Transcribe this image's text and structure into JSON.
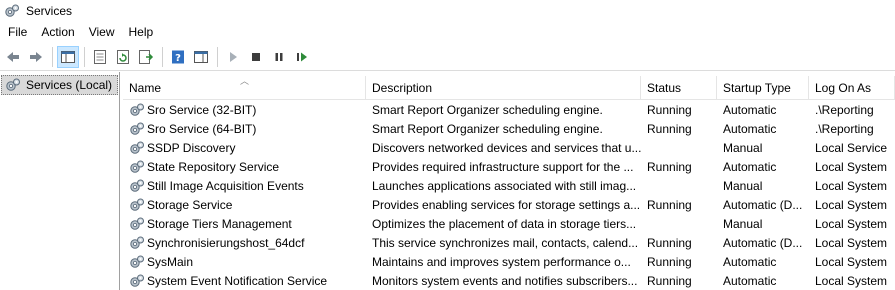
{
  "window": {
    "title": "Services",
    "icon": "services-gear-icon"
  },
  "menu": {
    "items": [
      "File",
      "Action",
      "View",
      "Help"
    ]
  },
  "toolbar": {
    "buttons": [
      {
        "name": "back-icon"
      },
      {
        "name": "forward-icon"
      },
      {
        "name": "show-hide-console-tree-icon"
      },
      {
        "name": "properties-icon"
      },
      {
        "name": "refresh-icon"
      },
      {
        "name": "export-list-icon"
      },
      {
        "name": "help-icon"
      },
      {
        "name": "show-action-pane-icon"
      },
      {
        "name": "start-service-icon"
      },
      {
        "name": "stop-service-icon"
      },
      {
        "name": "pause-service-icon"
      },
      {
        "name": "restart-service-icon"
      }
    ]
  },
  "tree": {
    "selected": "Services (Local)"
  },
  "table": {
    "columns": [
      "Name",
      "Description",
      "Status",
      "Startup Type",
      "Log On As"
    ],
    "rows": [
      {
        "name": "Sro Service (32-BIT)",
        "description": "Smart Report Organizer scheduling engine.",
        "status": "Running",
        "startup": "Automatic",
        "logon": ".\\Reporting"
      },
      {
        "name": "Sro Service (64-BIT)",
        "description": "Smart Report Organizer scheduling engine.",
        "status": "Running",
        "startup": "Automatic",
        "logon": ".\\Reporting"
      },
      {
        "name": "SSDP Discovery",
        "description": "Discovers networked devices and services that u...",
        "status": "",
        "startup": "Manual",
        "logon": "Local Service"
      },
      {
        "name": "State Repository Service",
        "description": "Provides required infrastructure support for the ...",
        "status": "Running",
        "startup": "Automatic",
        "logon": "Local System"
      },
      {
        "name": "Still Image Acquisition Events",
        "description": "Launches applications associated with still imag...",
        "status": "",
        "startup": "Manual",
        "logon": "Local System"
      },
      {
        "name": "Storage Service",
        "description": "Provides enabling services for storage settings a...",
        "status": "Running",
        "startup": "Automatic (D...",
        "logon": "Local System"
      },
      {
        "name": "Storage Tiers Management",
        "description": "Optimizes the placement of data in storage tiers...",
        "status": "",
        "startup": "Manual",
        "logon": "Local System"
      },
      {
        "name": "Synchronisierungshost_64dcf",
        "description": "This service synchronizes mail, contacts, calend...",
        "status": "Running",
        "startup": "Automatic (D...",
        "logon": "Local System"
      },
      {
        "name": "SysMain",
        "description": "Maintains and improves system performance o...",
        "status": "Running",
        "startup": "Automatic",
        "logon": "Local System"
      },
      {
        "name": "System Event Notification Service",
        "description": "Monitors system events and notifies subscribers...",
        "status": "Running",
        "startup": "Automatic",
        "logon": "Local System"
      }
    ]
  },
  "colors": {
    "selection": "#cce8ff",
    "tree_selected": "#d9d9d9",
    "divider": "#a0a0a0"
  }
}
